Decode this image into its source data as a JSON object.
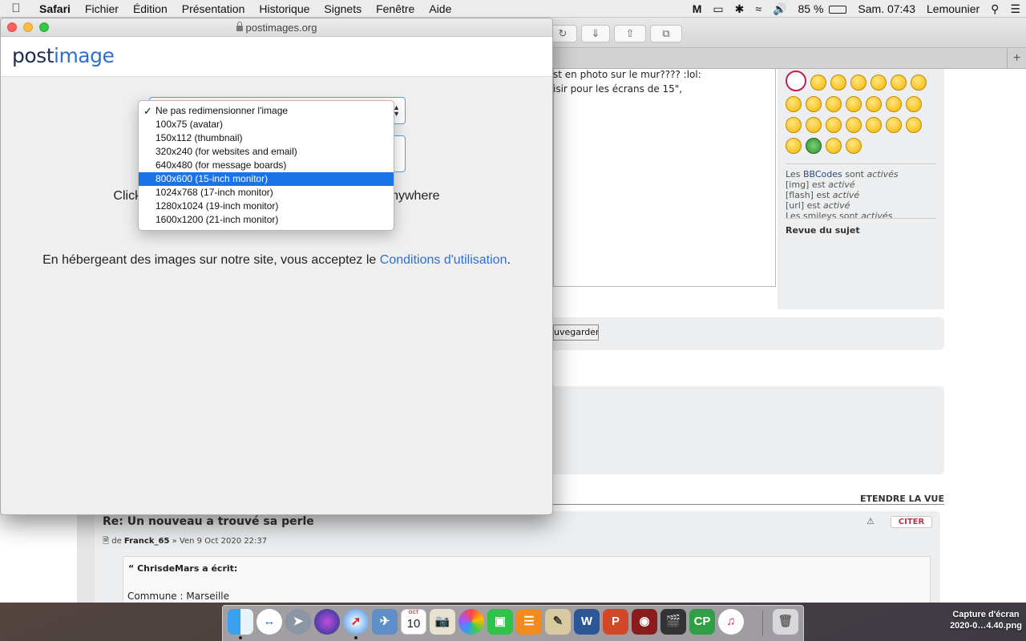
{
  "menubar": {
    "app": "Safari",
    "items": [
      "Fichier",
      "Édition",
      "Présentation",
      "Historique",
      "Signets",
      "Fenêtre",
      "Aide"
    ],
    "battery_percent": "85 %",
    "clock": "Sam. 07:43",
    "user": "Lemounier"
  },
  "postimage_window": {
    "url": "postimages.org",
    "logo_part1": "post",
    "logo_part2": "image",
    "click_text_left": "Click",
    "click_text_right": "nywhere",
    "terms_text": "En hébergeant des images sur notre site, vous acceptez le",
    "terms_link": "Conditions d'utilisation",
    "terms_end": ".",
    "resize_options": [
      "Ne pas redimensionner l'image",
      "100x75 (avatar)",
      "150x112 (thumbnail)",
      "320x240 (for websites and email)",
      "640x480 (for message boards)",
      "800x600 (15-inch monitor)",
      "1024x768 (17-inch monitor)",
      "1280x1024 (19-inch monitor)",
      "1600x1200 (21-inch monitor)"
    ],
    "checked_option": "Ne pas redimensionner l'image",
    "highlighted_option": "800x600 (15-inch monitor)"
  },
  "forum": {
    "message_line1": "st en photo sur le mur???? :lol:",
    "message_line2": "isir pour les écrans de 15\",",
    "bbcode_label": "BBCodes",
    "bbcode_prefix": "Les",
    "bbcode_suffix": "sont",
    "bbcode_state": "activés",
    "img_label": "[img] est",
    "img_state": "activé",
    "flash_label": "[flash] est",
    "flash_state": "activé",
    "url_label": "[url] est",
    "url_state": "activé",
    "smileys_label": "Les smileys sont",
    "smileys_state": "activés",
    "review_title": "Revue du sujet",
    "save_button": "uvegarder",
    "extend_view": "ETENDRE LA VUE",
    "post_title": "Re: Un nouveau a trouvé sa perle",
    "post_meta_prefix": "de",
    "post_author": "Franck_65",
    "post_meta_date": "» Ven 9 Oct 2020 22:37",
    "quote_button": "CITER",
    "quote_author": "ChrisdeMars a écrit:",
    "quote_text": "Commune : Marseille"
  },
  "dock": {
    "calendar_month": "OCT",
    "calendar_day": "10"
  },
  "desktop": {
    "file_name_line1": "Capture d'écran",
    "file_name_line2": "2020-0…4.40.png"
  }
}
